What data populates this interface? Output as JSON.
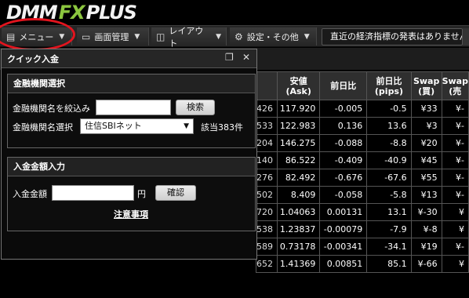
{
  "logo": {
    "part1": "DMM",
    "part2": "FX",
    "part3": "PLUS"
  },
  "menubar": {
    "menu": "メニュー",
    "screen": "画面管理",
    "layout": "レイアウト",
    "settings": "設定・その他",
    "news": "直近の経済指標の発表はありません。"
  },
  "panel": {
    "title": "クイック入金",
    "bank_section": {
      "title": "金融機関選択",
      "filter_label": "金融機関名を絞込み",
      "filter_value": "",
      "search_button": "検索",
      "select_label": "金融機関名選択",
      "select_value": "住信SBIネット",
      "count": "該当383件"
    },
    "amount_section": {
      "title": "入金金額入力",
      "amount_label": "入金金額",
      "amount_value": "",
      "unit": "円",
      "confirm_button": "確認",
      "notes_link": "注意事項"
    }
  },
  "rates_table": {
    "headers": [
      "",
      "安値\n(Ask)",
      "前日比",
      "前日比\n(pips)",
      "Swap\n(買)",
      "Swap\n(売"
    ],
    "header_lines": [
      [
        "",
        ""
      ],
      [
        "安値",
        "(Ask)"
      ],
      [
        "前日比",
        ""
      ],
      [
        "前日比",
        "(pips)"
      ],
      [
        "Swap",
        "(買)"
      ],
      [
        "Swap",
        "(売"
      ]
    ],
    "rows": [
      [
        "426",
        "117.920",
        "-0.005",
        "-0.5",
        "¥33",
        "¥-"
      ],
      [
        "533",
        "122.983",
        "0.136",
        "13.6",
        "¥3",
        "¥-"
      ],
      [
        "204",
        "146.275",
        "-0.088",
        "-8.8",
        "¥20",
        "¥-"
      ],
      [
        "140",
        "86.522",
        "-0.409",
        "-40.9",
        "¥45",
        "¥-"
      ],
      [
        "276",
        "82.492",
        "-0.676",
        "-67.6",
        "¥55",
        "¥-"
      ],
      [
        "502",
        "8.409",
        "-0.058",
        "-5.8",
        "¥13",
        "¥-"
      ],
      [
        "720",
        "1.04063",
        "0.00131",
        "13.1",
        "¥-30",
        "¥"
      ],
      [
        "538",
        "1.23837",
        "-0.00079",
        "-7.9",
        "¥-8",
        "¥"
      ],
      [
        "589",
        "0.73178",
        "-0.00341",
        "-34.1",
        "¥19",
        "¥-"
      ],
      [
        "652",
        "1.41369",
        "0.00851",
        "85.1",
        "¥-66",
        "¥"
      ]
    ]
  }
}
